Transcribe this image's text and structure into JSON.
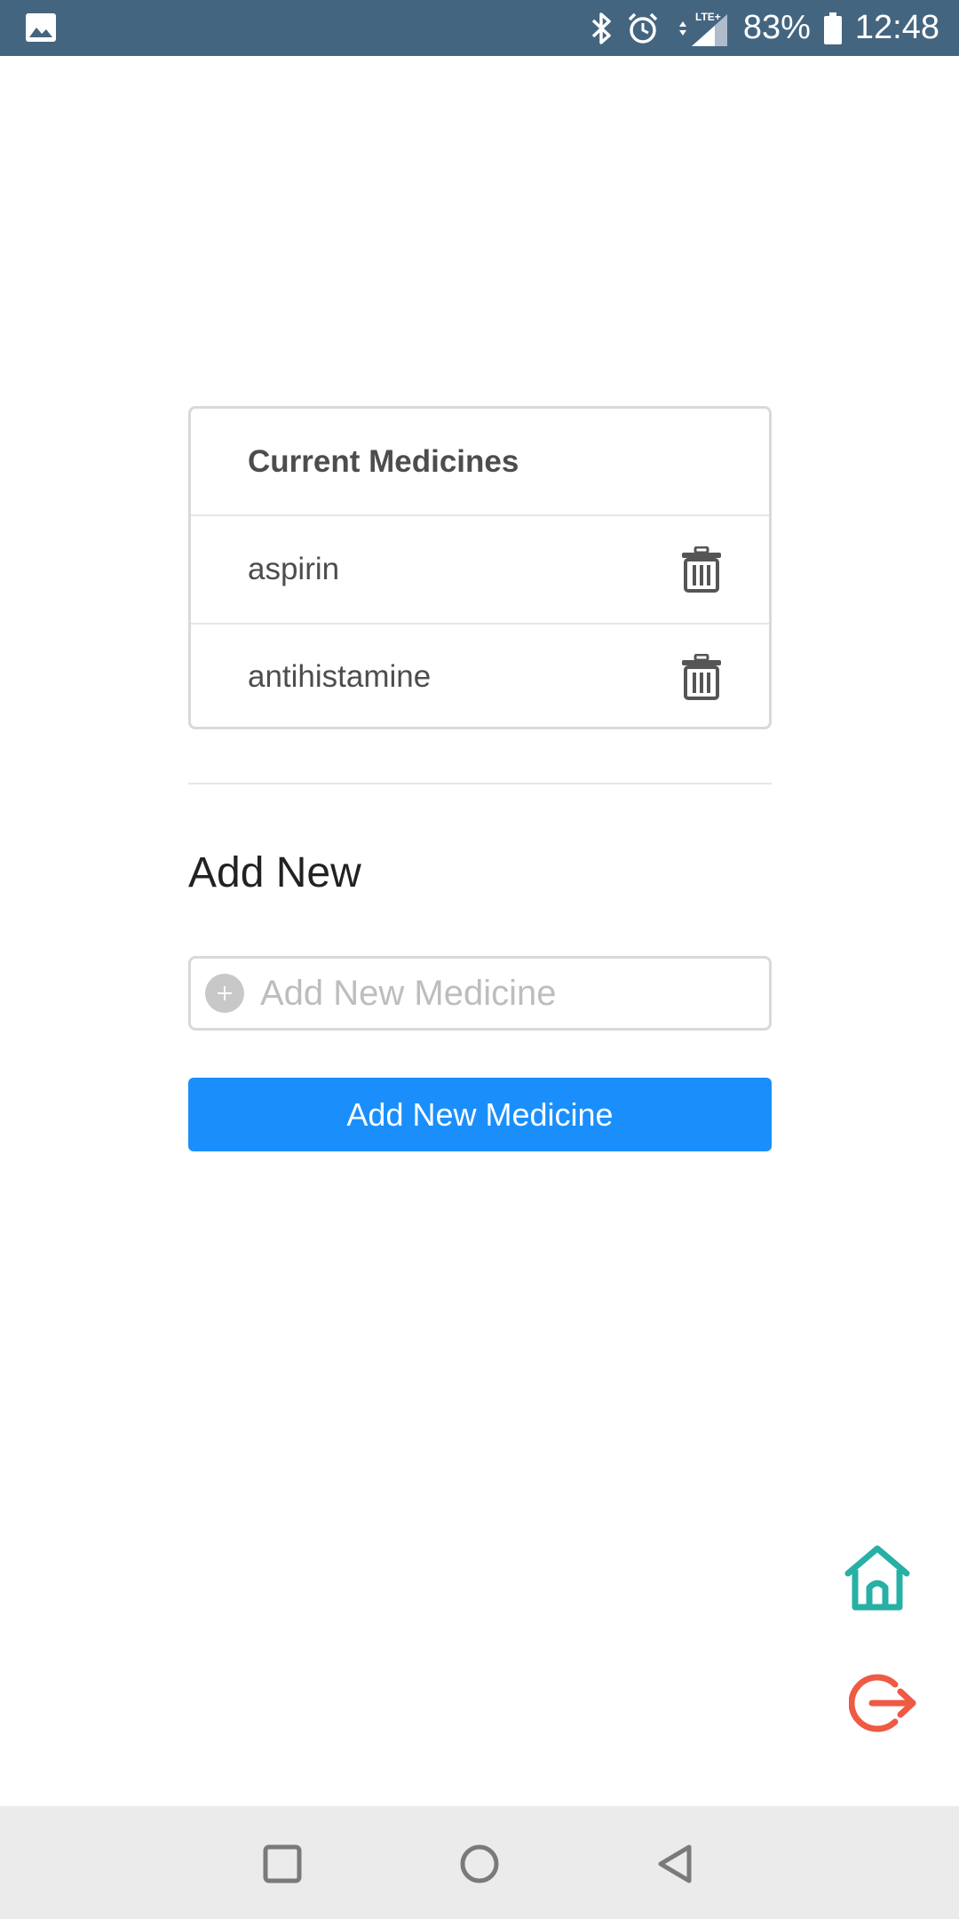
{
  "status_bar": {
    "battery": "83%",
    "time": "12:48",
    "network": "LTE"
  },
  "medicines_card": {
    "title": "Current Medicines",
    "items": [
      {
        "name": "aspirin"
      },
      {
        "name": "antihistamine"
      }
    ]
  },
  "add_section": {
    "title": "Add New",
    "input_placeholder": "Add New Medicine",
    "input_value": "",
    "button_label": "Add New Medicine"
  },
  "icons": {
    "home": "home-icon",
    "logout": "logout-icon",
    "delete": "trash-icon"
  },
  "colors": {
    "status_bar": "#446580",
    "primary_button": "#1a8ffc",
    "home_icon": "#27b0a5",
    "logout_icon": "#ee5a43"
  }
}
